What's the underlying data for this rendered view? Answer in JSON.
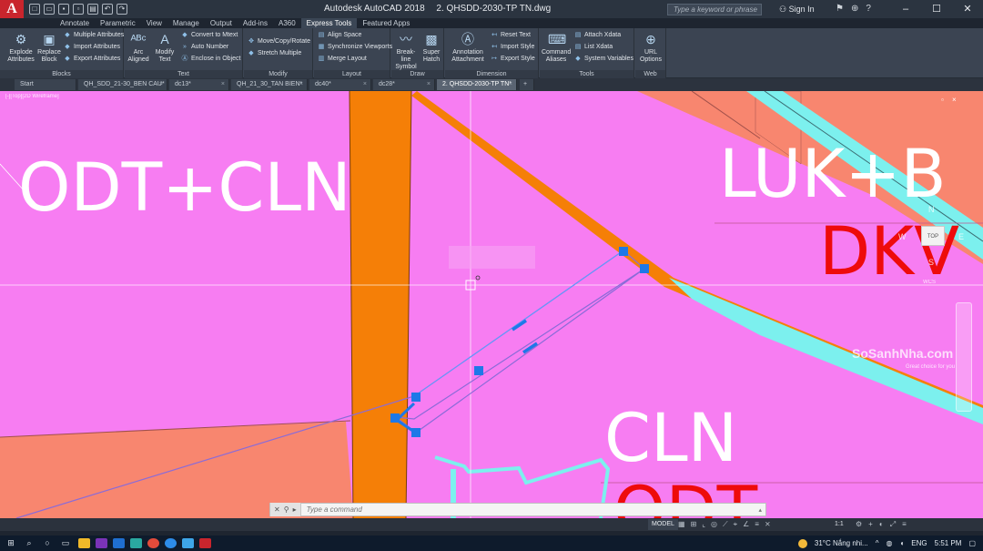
{
  "titlebar": {
    "app_name": "Autodesk AutoCAD 2018",
    "file_name": "2. QHSDD-2030-TP TN.dwg",
    "search_placeholder": "Type a keyword or phrase",
    "signin_label": "Sign In",
    "logo_letter": "A"
  },
  "ribbon_tabs": [
    {
      "label": "Annotate"
    },
    {
      "label": "Parametric"
    },
    {
      "label": "View"
    },
    {
      "label": "Manage"
    },
    {
      "label": "Output"
    },
    {
      "label": "Add-ins"
    },
    {
      "label": "A360"
    },
    {
      "label": "Express Tools",
      "active": true
    },
    {
      "label": "Featured Apps"
    }
  ],
  "ribbon": {
    "blocks": {
      "title": "Blocks",
      "explode": "Explode Attributes",
      "replace": "Replace Block",
      "edit_attr": "Multiple Attributes",
      "import_attr": "Import Attributes",
      "export_attr": "Export Attributes"
    },
    "text": {
      "title": "Text",
      "arc_aligned": "Arc Aligned",
      "modify_text": "Modify Text",
      "convert_mtext": "Convert to Mtext",
      "auto_number": "Auto Number",
      "enclose": "Enclose in Object"
    },
    "modify": {
      "title": "Modify",
      "move_copy_rotate": "Move/Copy/Rotate",
      "stretch_multiple": "Stretch Multiple"
    },
    "layout": {
      "title": "Layout",
      "align_space": "Align Space",
      "sync_viewports": "Synchronize Viewports",
      "merge_layout": "Merge Layout"
    },
    "draw": {
      "title": "Draw",
      "breakline": "Break-line Symbol",
      "super_hatch": "Super Hatch"
    },
    "dimension": {
      "title": "Dimension",
      "annotation_attachment": "Annotation Attachment",
      "reset_text": "Reset Text",
      "import_style": "Import Style",
      "export_style": "Export Style"
    },
    "tools": {
      "title": "Tools",
      "command_aliases": "Command Aliases",
      "attach_xdata": "Attach Xdata",
      "list_xdata": "List Xdata",
      "system_variables": "System Variables"
    },
    "web": {
      "title": "Web",
      "url_options": "URL Options"
    }
  },
  "doc_tabs": [
    {
      "label": "Start"
    },
    {
      "label": "QH_SDD_21-30_BEN CAU*"
    },
    {
      "label": "dc13*"
    },
    {
      "label": "QH_21_30_TAN BIEN*"
    },
    {
      "label": "dc40*"
    },
    {
      "label": "dc28*"
    },
    {
      "label": "2. QHSDD-2030-TP TN*",
      "active": true
    }
  ],
  "drawing": {
    "viewport_label": "[-][Top][2D Wireframe]",
    "labels": {
      "odt_cln": "ODT+CLN",
      "luk_b": "LUK+B",
      "cln": "CLN",
      "dkv": "DKV",
      "odt_bottom": "ODT"
    },
    "colors": {
      "land_magenta": "#f77df2",
      "road_orange": "#f57f07",
      "land_salmon": "#f8866f",
      "water_cyan": "#7cf0ee",
      "selection_blue": "#1e78e8"
    },
    "watermark": "SoSanhNha.com",
    "watermark_sub": "Great choice for you",
    "viewcube": {
      "n": "N",
      "w": "W",
      "e": "E",
      "s": "S",
      "top": "TOP",
      "wcs": "WCS"
    }
  },
  "command_line": {
    "placeholder": "Type a command"
  },
  "statusbar": {
    "model": "MODEL",
    "scale": "1:1"
  },
  "taskbar": {
    "weather": "31°C  Nắng nhi...",
    "lang": "ENG",
    "time": "5:51 PM"
  }
}
